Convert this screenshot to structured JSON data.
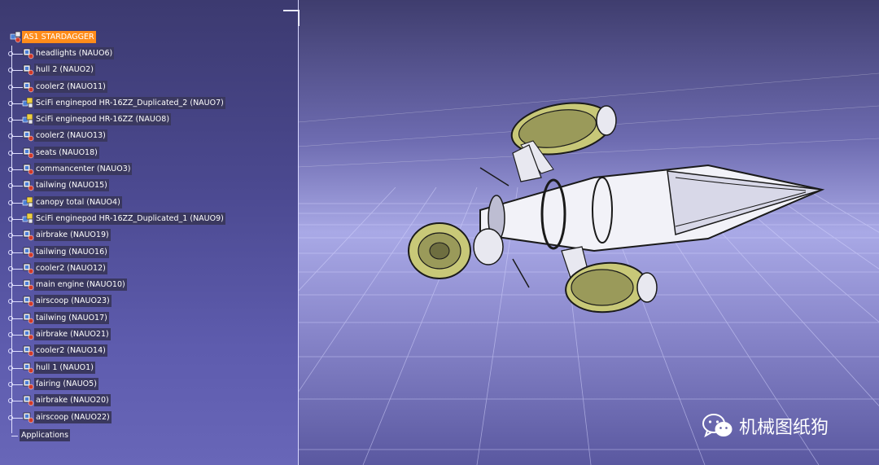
{
  "specification_tree": {
    "root": {
      "label": "AS1 STARDAGGER",
      "icon": "assembly-icon"
    },
    "items": [
      {
        "label": "headlights (NAUO6)",
        "icon": "part-icon"
      },
      {
        "label": "hull 2 (NAUO2)",
        "icon": "part-icon"
      },
      {
        "label": "cooler2 (NAUO11)",
        "icon": "part-icon"
      },
      {
        "label": "SciFi enginepod HR-16ZZ_Duplicated_2 (NAUO7)",
        "icon": "product-icon"
      },
      {
        "label": "SciFi enginepod HR-16ZZ (NAUO8)",
        "icon": "product-icon"
      },
      {
        "label": "cooler2 (NAUO13)",
        "icon": "part-icon"
      },
      {
        "label": "seats (NAUO18)",
        "icon": "part-icon"
      },
      {
        "label": "commancenter (NAUO3)",
        "icon": "part-icon"
      },
      {
        "label": "tailwing (NAUO15)",
        "icon": "part-icon"
      },
      {
        "label": "canopy total (NAUO4)",
        "icon": "product-icon"
      },
      {
        "label": "SciFi enginepod HR-16ZZ_Duplicated_1 (NAUO9)",
        "icon": "product-icon"
      },
      {
        "label": "airbrake (NAUO19)",
        "icon": "part-icon"
      },
      {
        "label": "tailwing (NAUO16)",
        "icon": "part-icon"
      },
      {
        "label": "cooler2 (NAUO12)",
        "icon": "part-icon"
      },
      {
        "label": "main engine (NAUO10)",
        "icon": "part-icon"
      },
      {
        "label": "airscoop (NAUO23)",
        "icon": "part-icon"
      },
      {
        "label": "tailwing (NAUO17)",
        "icon": "part-icon"
      },
      {
        "label": "airbrake (NAUO21)",
        "icon": "part-icon"
      },
      {
        "label": "cooler2 (NAUO14)",
        "icon": "part-icon"
      },
      {
        "label": "hull 1 (NAUO1)",
        "icon": "part-icon"
      },
      {
        "label": "fairing (NAUO5)",
        "icon": "part-icon"
      },
      {
        "label": "airbrake (NAUO20)",
        "icon": "part-icon"
      },
      {
        "label": "airscoop (NAUO22)",
        "icon": "part-icon"
      }
    ],
    "applications_label": "Applications"
  },
  "watermark": {
    "text": "机械图纸狗",
    "icon": "wechat-icon"
  },
  "colors": {
    "selected_highlight": "#ff8c1a",
    "label_background": "#3a385f",
    "model_body": "#f2f2f8",
    "engine_pod": "#c8c878"
  }
}
